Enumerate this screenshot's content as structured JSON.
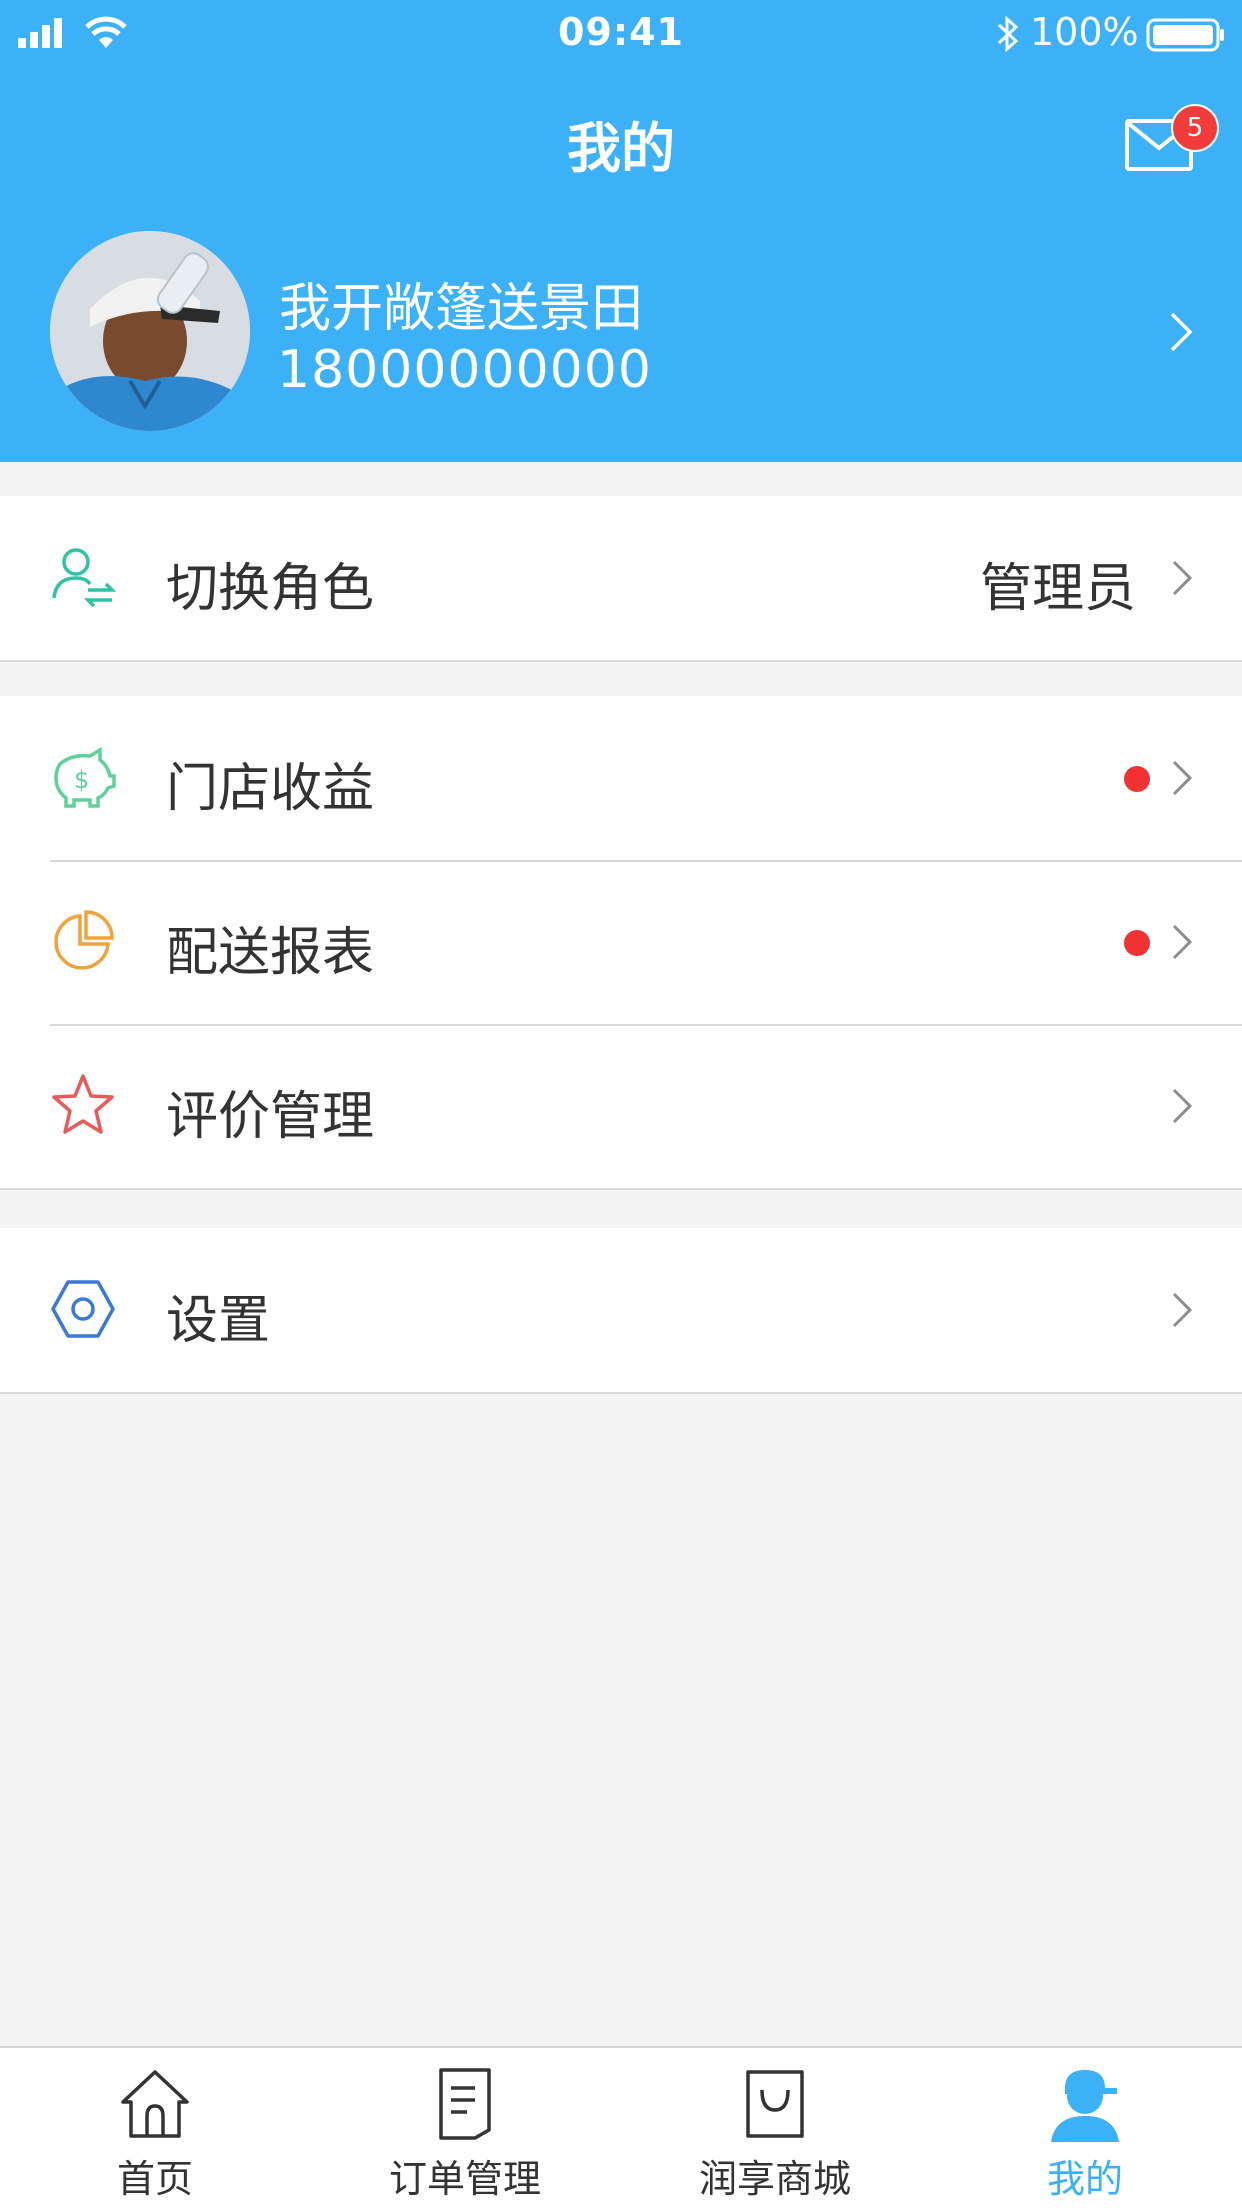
{
  "status_bar": {
    "time": "09:41",
    "battery": "100%"
  },
  "header": {
    "title": "我的",
    "mail_badge": "5",
    "user": {
      "name": "我开敞篷送景田",
      "phone": "18000000000"
    }
  },
  "groups": [
    [
      {
        "icon": "switch-role-icon",
        "label": "切换角色",
        "value": "管理员"
      }
    ],
    [
      {
        "icon": "piggy-bank-icon",
        "label": "门店收益",
        "dot": true
      },
      {
        "icon": "pie-chart-icon",
        "label": "配送报表",
        "dot": true
      },
      {
        "icon": "star-icon",
        "label": "评价管理"
      }
    ],
    [
      {
        "icon": "settings-hex-icon",
        "label": "设置"
      }
    ]
  ],
  "tabbar": [
    {
      "icon": "home-icon",
      "label": "首页"
    },
    {
      "icon": "order-icon",
      "label": "订单管理"
    },
    {
      "icon": "shopping-bag-icon",
      "label": "润享商城"
    },
    {
      "icon": "profile-icon",
      "label": "我的",
      "active": true
    }
  ],
  "colors": {
    "primary": "#3cb1f8",
    "badge": "#f03232",
    "background": "#f4f4f4"
  }
}
